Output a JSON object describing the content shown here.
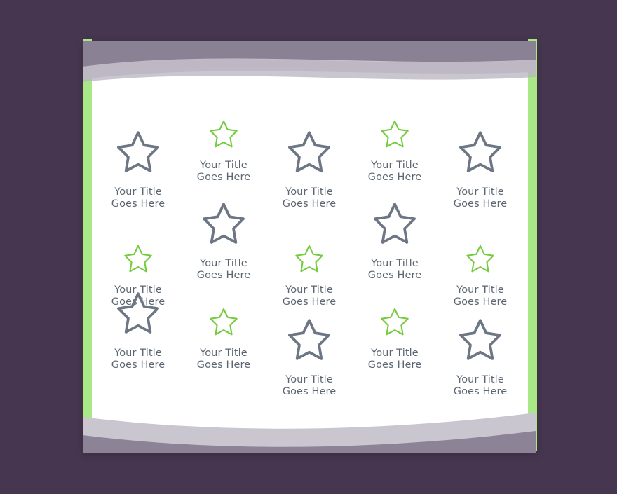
{
  "theme": {
    "background_color": "#46364f",
    "paper_color": "#ffffff",
    "accent_green": "#a8e887",
    "star_green": "#76cc3f",
    "star_gray": "#6c7684",
    "text_color": "#5c6673",
    "wave_light": "#c9c6cf",
    "wave_dark": "#857b90"
  },
  "slide": {
    "title_text": "Your Title\nGoes Here",
    "rows": [
      {
        "row_index": 1,
        "items": [
          {
            "star_color": "gray",
            "size": "large",
            "align": "down",
            "label": "Your Title\nGoes Here"
          },
          {
            "star_color": "green",
            "size": "small",
            "align": "up",
            "label": "Your Title\nGoes Here"
          },
          {
            "star_color": "gray",
            "size": "large",
            "align": "down",
            "label": "Your Title\nGoes Here"
          },
          {
            "star_color": "green",
            "size": "small",
            "align": "up",
            "label": "Your Title\nGoes Here"
          },
          {
            "star_color": "gray",
            "size": "large",
            "align": "down",
            "label": "Your Title\nGoes Here"
          }
        ]
      },
      {
        "row_index": 2,
        "items": [
          {
            "star_color": "green",
            "size": "small",
            "align": "down",
            "label": "Your Title\nGoes Here"
          },
          {
            "star_color": "gray",
            "size": "large",
            "align": "up",
            "label": "Your Title\nGoes Here"
          },
          {
            "star_color": "green",
            "size": "small",
            "align": "down",
            "label": "Your Title\nGoes Here"
          },
          {
            "star_color": "gray",
            "size": "large",
            "align": "up",
            "label": "Your Title\nGoes Here"
          },
          {
            "star_color": "green",
            "size": "small",
            "align": "down",
            "label": "Your Title\nGoes Here"
          }
        ]
      },
      {
        "row_index": 3,
        "items": [
          {
            "star_color": "gray",
            "size": "large",
            "align": "up",
            "label": "Your Title\nGoes Here"
          },
          {
            "star_color": "green",
            "size": "small",
            "align": "up",
            "label": "Your Title\nGoes Here"
          },
          {
            "star_color": "gray",
            "size": "large",
            "align": "down",
            "label": "Your Title\nGoes Here"
          },
          {
            "star_color": "green",
            "size": "small",
            "align": "up",
            "label": "Your Title\nGoes Here"
          },
          {
            "star_color": "gray",
            "size": "large",
            "align": "down",
            "label": "Your Title\nGoes Here"
          }
        ]
      }
    ]
  }
}
